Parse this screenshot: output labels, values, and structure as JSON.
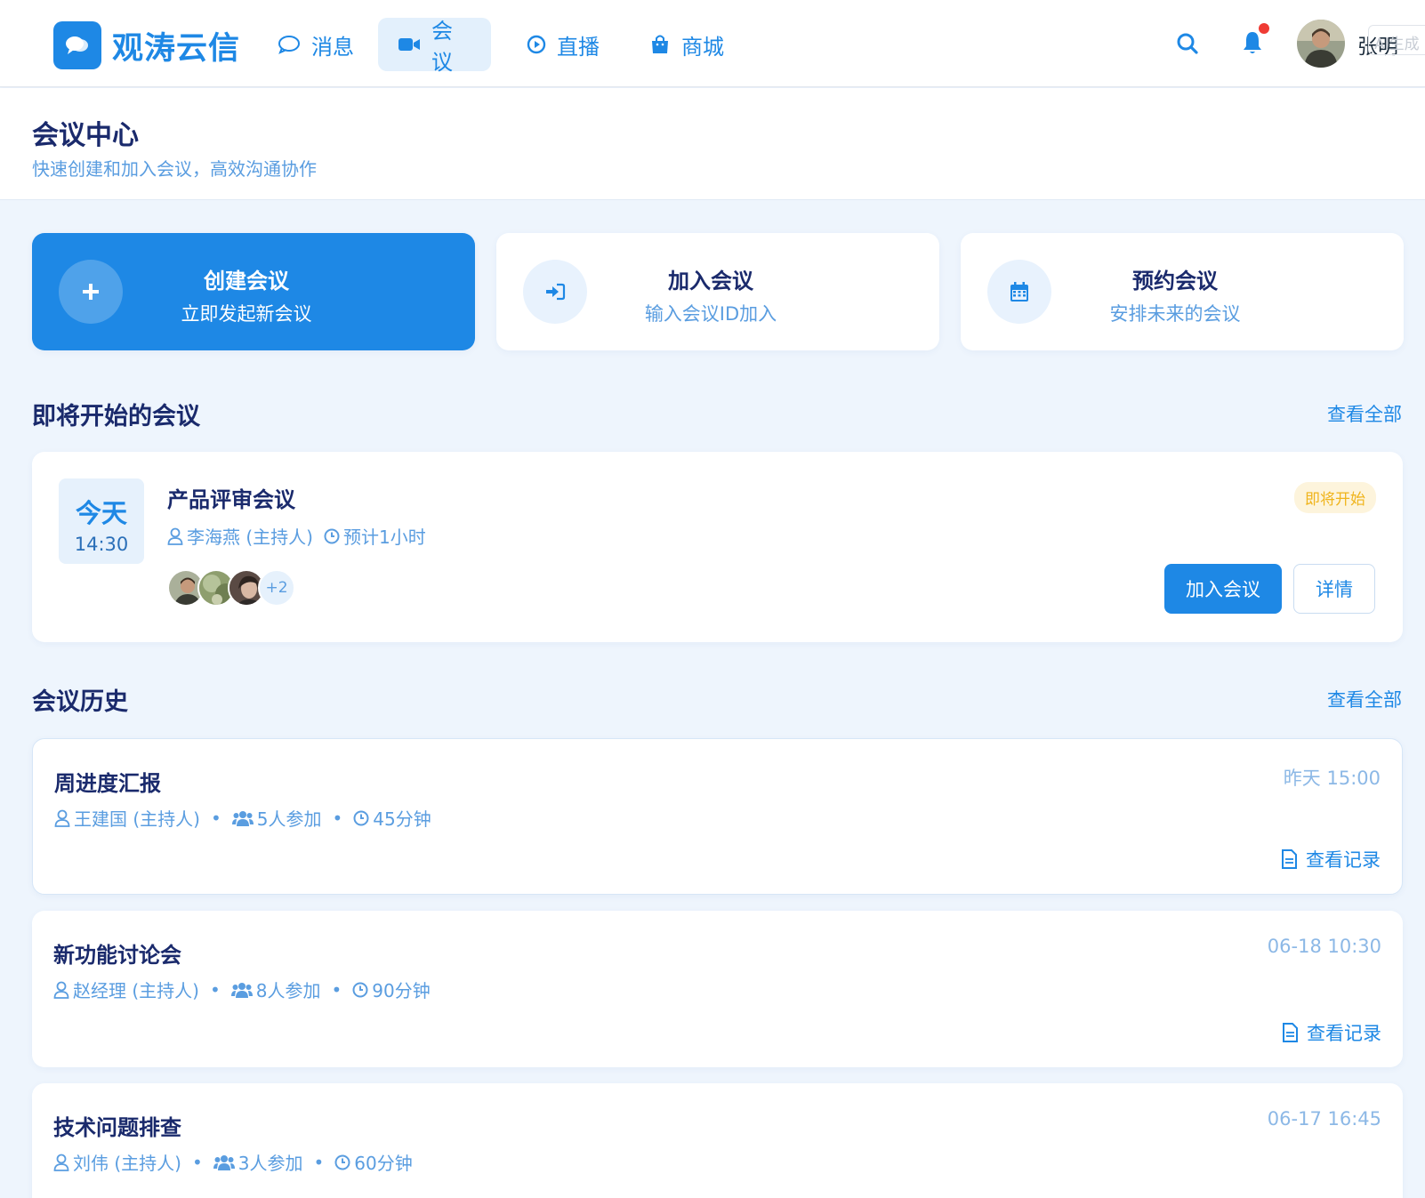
{
  "brand": {
    "name": "观涛云信",
    "logo_icon": "chat-bubbles-icon"
  },
  "nav": [
    {
      "label": "消息",
      "icon": "message-icon",
      "active": false
    },
    {
      "label": "会议",
      "icon": "video-camera-icon",
      "active": true
    },
    {
      "label": "直播",
      "icon": "play-circle-icon",
      "active": false
    },
    {
      "label": "商城",
      "icon": "shopping-bag-icon",
      "active": false
    }
  ],
  "header_right": {
    "user_name": "张明",
    "ghost_tag": "AI生成"
  },
  "page": {
    "title": "会议中心",
    "subtitle": "快速创建和加入会议，高效沟通协作"
  },
  "actions": [
    {
      "title": "创建会议",
      "desc": "立即发起新会议",
      "icon": "plus-icon"
    },
    {
      "title": "加入会议",
      "desc": "输入会议ID加入",
      "icon": "sign-in-icon"
    },
    {
      "title": "预约会议",
      "desc": "安排未来的会议",
      "icon": "calendar-icon"
    }
  ],
  "upcoming": {
    "section_title": "即将开始的会议",
    "view_all": "查看全部",
    "meeting": {
      "day": "今天",
      "time": "14:30",
      "title": "产品评审会议",
      "host": "李海燕 (主持人)",
      "duration": "预计1小时",
      "status": "即将开始",
      "extra_attendees": "+2",
      "join_label": "加入会议",
      "detail_label": "详情"
    }
  },
  "history": {
    "section_title": "会议历史",
    "view_all": "查看全部",
    "record_label": "查看记录",
    "items": [
      {
        "title": "周进度汇报",
        "time": "昨天 15:00",
        "host": "王建国 (主持人)",
        "participants": "5人参加",
        "duration": "45分钟"
      },
      {
        "title": "新功能讨论会",
        "time": "06-18 10:30",
        "host": "赵经理 (主持人)",
        "participants": "8人参加",
        "duration": "90分钟"
      },
      {
        "title": "技术问题排查",
        "time": "06-17 16:45",
        "host": "刘伟 (主持人)",
        "participants": "3人参加",
        "duration": "60分钟"
      }
    ]
  },
  "colors": {
    "accent": "#1e88e5",
    "title": "#1a2a6c",
    "muted": "#5a9de0",
    "warning": "#f0b41c",
    "background": "#eef5fd"
  }
}
